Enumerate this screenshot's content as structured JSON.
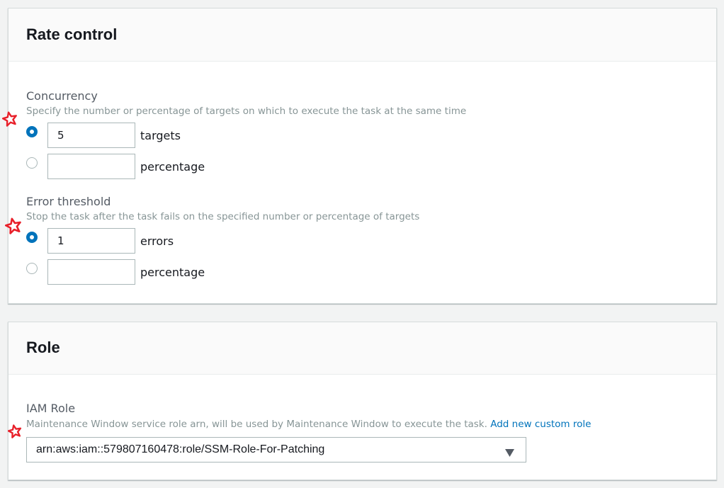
{
  "rate_control": {
    "title": "Rate control",
    "concurrency": {
      "label": "Concurrency",
      "description": "Specify the number or percentage of targets on which to execute the task at the same time",
      "options": [
        {
          "value": "5",
          "unit": "targets",
          "selected": true
        },
        {
          "value": "",
          "unit": "percentage",
          "selected": false
        }
      ]
    },
    "error_threshold": {
      "label": "Error threshold",
      "description": "Stop the task after the task fails on the specified number or percentage of targets",
      "options": [
        {
          "value": "1",
          "unit": "errors",
          "selected": true
        },
        {
          "value": "",
          "unit": "percentage",
          "selected": false
        }
      ]
    }
  },
  "role": {
    "title": "Role",
    "iam_role": {
      "label": "IAM Role",
      "description": "Maintenance Window service role arn, will be used by Maintenance Window to execute the task.",
      "link": "Add new custom role",
      "selected_value": "arn:aws:iam::579807160478:role/SSM-Role-For-Patching"
    }
  },
  "colors": {
    "accent": "#0073bb",
    "annotation_star": "#e8202a",
    "page_bg": "#f2f3f3"
  },
  "icons": [
    "annotation-star-icon",
    "dropdown-caret-icon"
  ]
}
